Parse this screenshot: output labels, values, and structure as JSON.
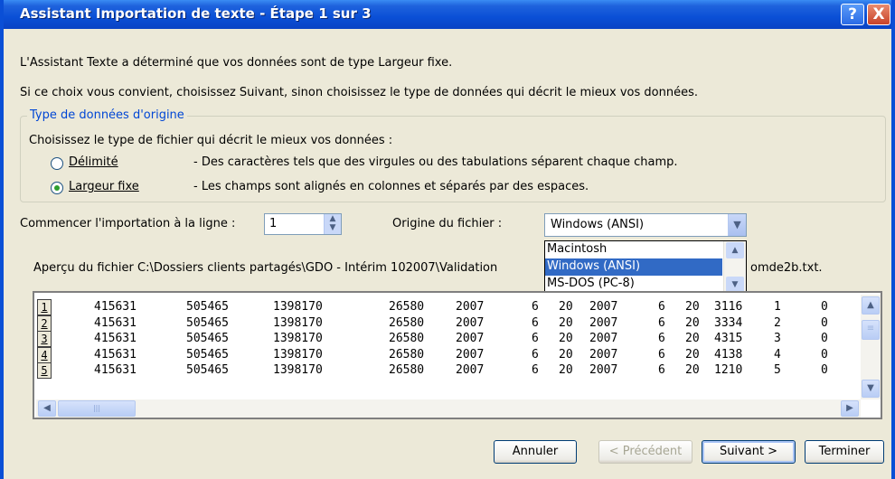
{
  "window": {
    "title": "Assistant Importation de texte - Étape 1 sur 3",
    "help_button": "?",
    "close_button": "X"
  },
  "intro": {
    "line1": "L'Assistant Texte a déterminé que vos données sont de type Largeur fixe.",
    "line2": "Si ce choix vous convient, choisissez Suivant, sinon choisissez le type de données qui décrit le mieux vos données."
  },
  "origin_type": {
    "legend": "Type de données d'origine",
    "prompt": "Choisissez le type de fichier qui décrit le mieux vos données :",
    "options": [
      {
        "label": "Délimité",
        "description": "- Des caractères tels que des virgules ou des tabulations séparent chaque champ.",
        "checked": false
      },
      {
        "label": "Largeur fixe",
        "description": "- Les champs sont alignés en colonnes et séparés par des espaces.",
        "checked": true
      }
    ]
  },
  "start_row": {
    "label": "Commencer l'importation à la ligne :",
    "value": "1"
  },
  "file_origin": {
    "label": "Origine du fichier :",
    "value": "Windows (ANSI)",
    "options": [
      "Macintosh",
      "Windows (ANSI)",
      "MS-DOS (PC-8)"
    ],
    "selected_index": 1
  },
  "preview": {
    "label_start": "Aperçu du fichier C:\\Dossiers clients partagés\\GDO - Intérim 102007\\Validation",
    "label_end": "omde2b.txt.",
    "rows": [
      {
        "num": "1",
        "cells": [
          "415631",
          "505465",
          "1398170",
          "26580",
          "2007",
          "6",
          "20",
          "2007",
          "6",
          "20",
          "3116",
          "1",
          "0"
        ]
      },
      {
        "num": "2",
        "cells": [
          "415631",
          "505465",
          "1398170",
          "26580",
          "2007",
          "6",
          "20",
          "2007",
          "6",
          "20",
          "3334",
          "2",
          "0"
        ]
      },
      {
        "num": "3",
        "cells": [
          "415631",
          "505465",
          "1398170",
          "26580",
          "2007",
          "6",
          "20",
          "2007",
          "6",
          "20",
          "4315",
          "3",
          "0"
        ]
      },
      {
        "num": "4",
        "cells": [
          "415631",
          "505465",
          "1398170",
          "26580",
          "2007",
          "6",
          "20",
          "2007",
          "6",
          "20",
          "4138",
          "4",
          "0"
        ]
      },
      {
        "num": "5",
        "cells": [
          "415631",
          "505465",
          "1398170",
          "26580",
          "2007",
          "6",
          "20",
          "2007",
          "6",
          "20",
          "1210",
          "5",
          "0"
        ]
      }
    ]
  },
  "buttons": {
    "cancel": "Annuler",
    "previous": "< Précédent",
    "next": "Suivant >",
    "finish": "Terminer"
  }
}
